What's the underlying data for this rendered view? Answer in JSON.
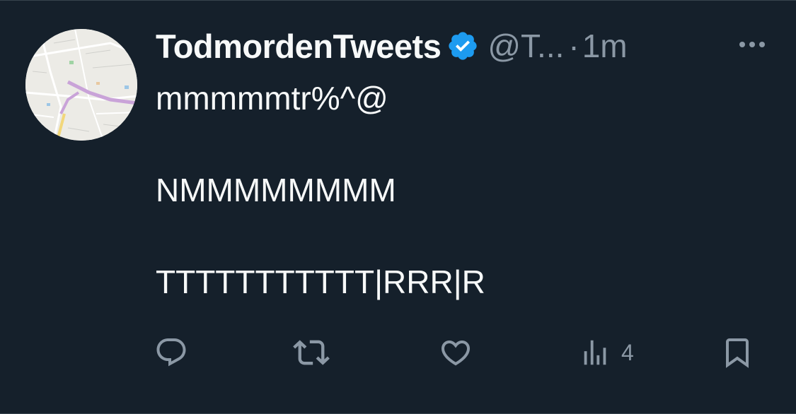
{
  "tweet": {
    "display_name": "TodmordenTweets",
    "handle": "@T...",
    "separator": "·",
    "time": "1m",
    "lines": [
      "mmmmmtr%^@",
      "NMMMMMMMM",
      "TTTTTTTTTTT|RRR|R"
    ]
  },
  "actions": {
    "reply_icon": "reply-icon",
    "retweet_icon": "retweet-icon",
    "like_icon": "heart-icon",
    "views_icon": "analytics-icon",
    "views_count": "4",
    "bookmark_icon": "bookmark-icon"
  },
  "colors": {
    "background": "#15202b",
    "text": "#f7f9f9",
    "muted": "#8b98a5",
    "verified": "#1d9bf0"
  }
}
